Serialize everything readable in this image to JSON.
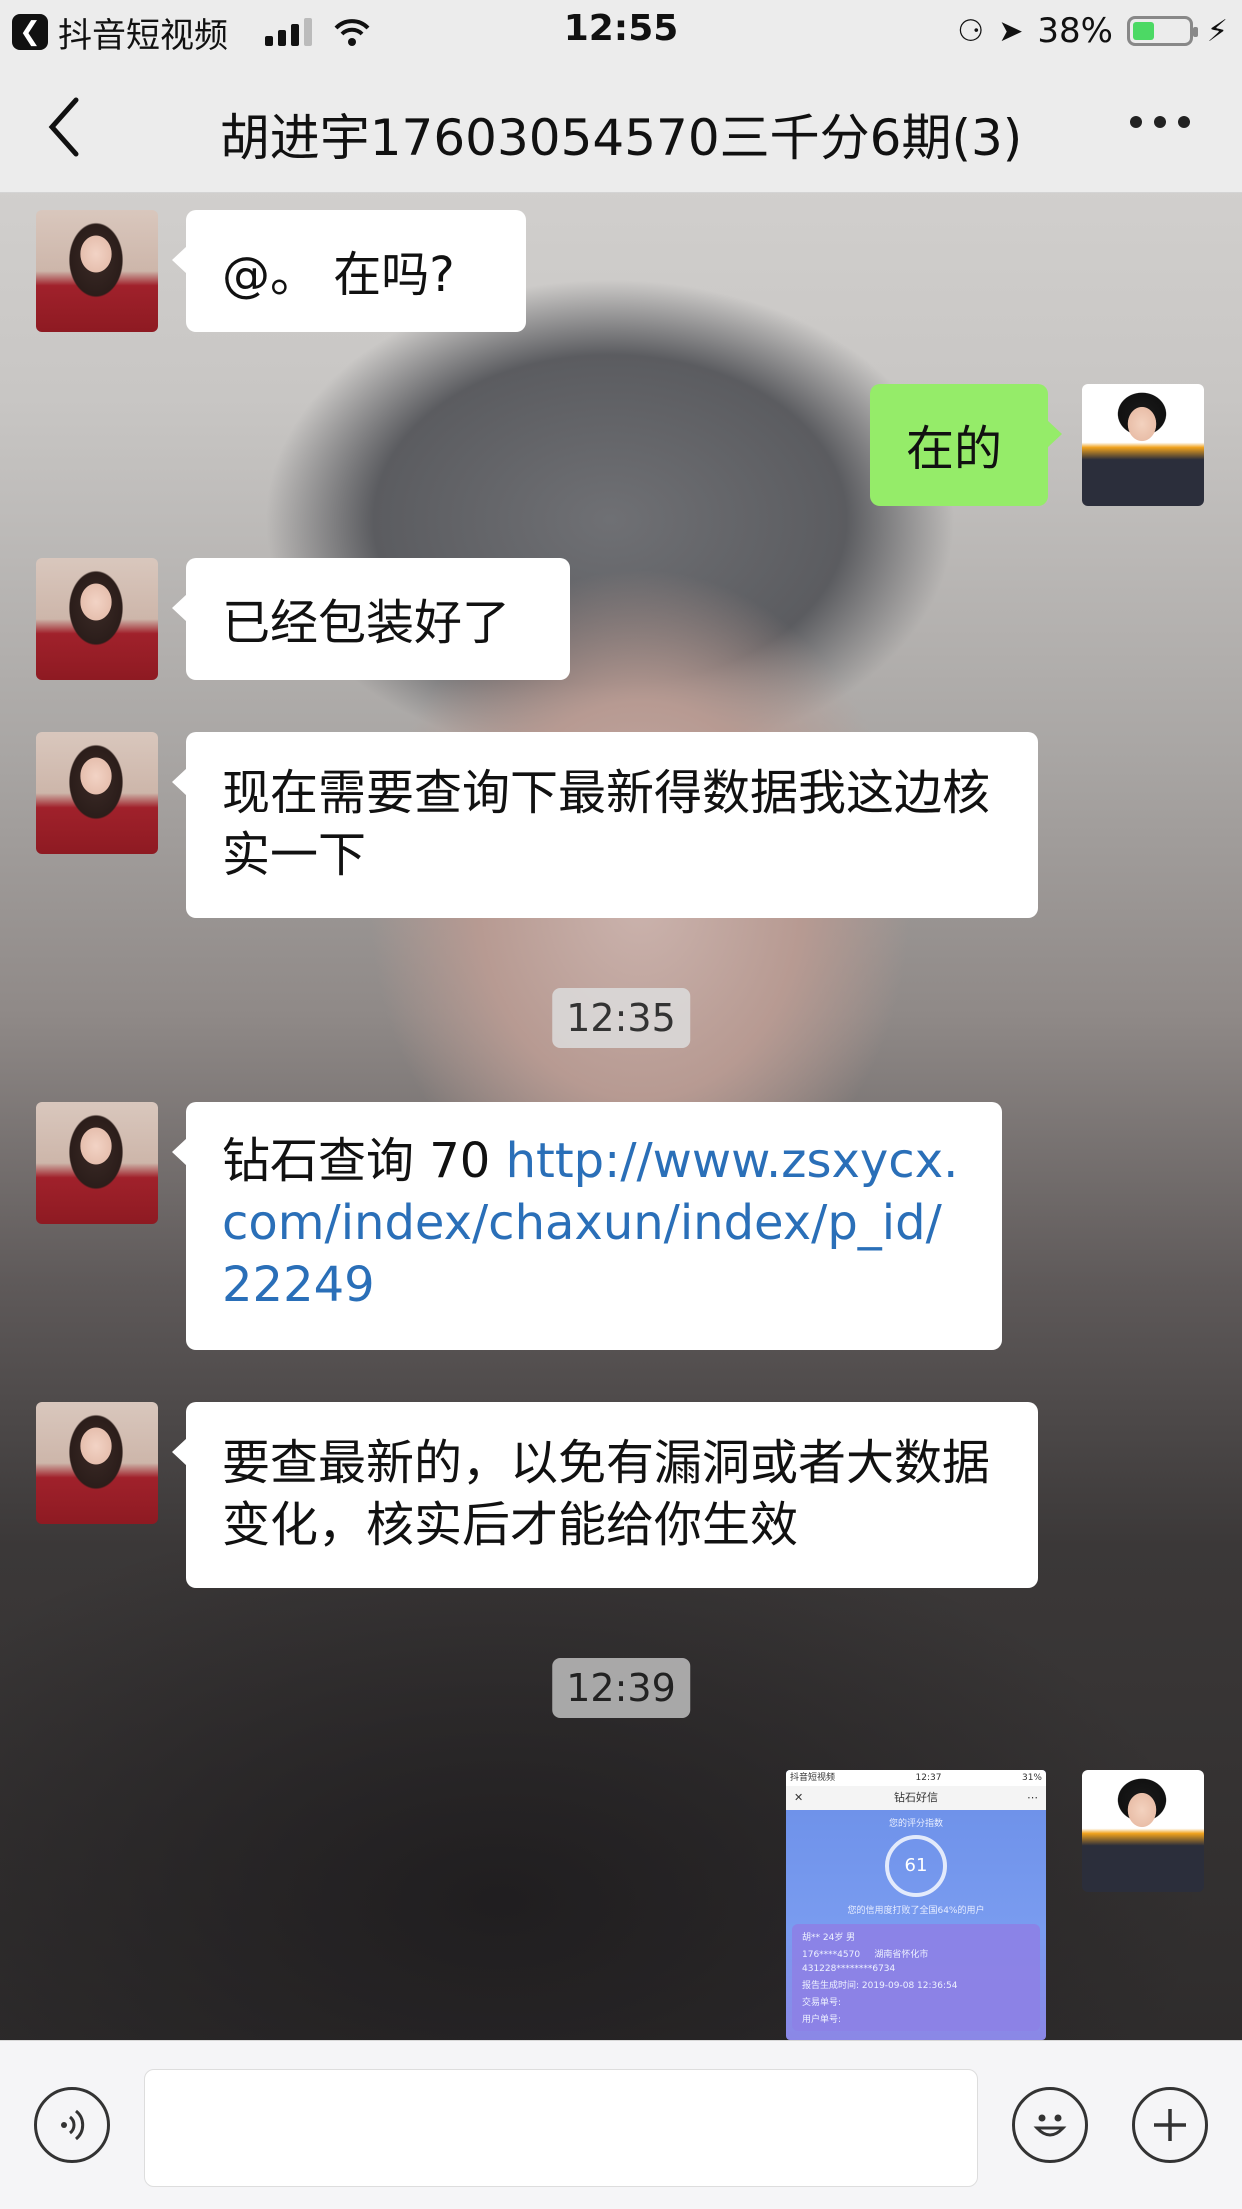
{
  "status_bar": {
    "back_app": "抖音短视频",
    "time": "12:55",
    "battery": "38%",
    "battery_level": 0.38
  },
  "nav": {
    "title": "胡进宇17603054570三千分6期(3)"
  },
  "messages": [
    {
      "side": "left",
      "text": "@。 在吗?"
    },
    {
      "side": "right",
      "text": "在的"
    },
    {
      "side": "left",
      "text": "已经包装好了"
    },
    {
      "side": "left",
      "text": "现在需要查询下最新得数据我这边核实一下"
    },
    {
      "side": "left",
      "text_prefix": "钻石查询 70 ",
      "link": "http://www.zsxycx.com/index/chaxun/index/p_id/22249"
    },
    {
      "side": "left",
      "text": "要查最新的，以免有漏洞或者大数据变化，核实后才能给你生效"
    }
  ],
  "timestamps": [
    "12:35",
    "12:39"
  ],
  "image_message": {
    "status_left": "抖音短视频",
    "status_time": "12:37",
    "status_right": "31%",
    "title": "钻石好信",
    "subtitle": "您的评分指数",
    "score": "61",
    "beat_text": "您的信用度打败了全国64%的用户",
    "lines": [
      "胡** 24岁 男",
      "176****4570",
      "431228********6734",
      "报告生成时间: 2019-09-08 12:36:54",
      "交易单号:",
      "用户单号:"
    ],
    "region": "湖南省怀化市"
  }
}
